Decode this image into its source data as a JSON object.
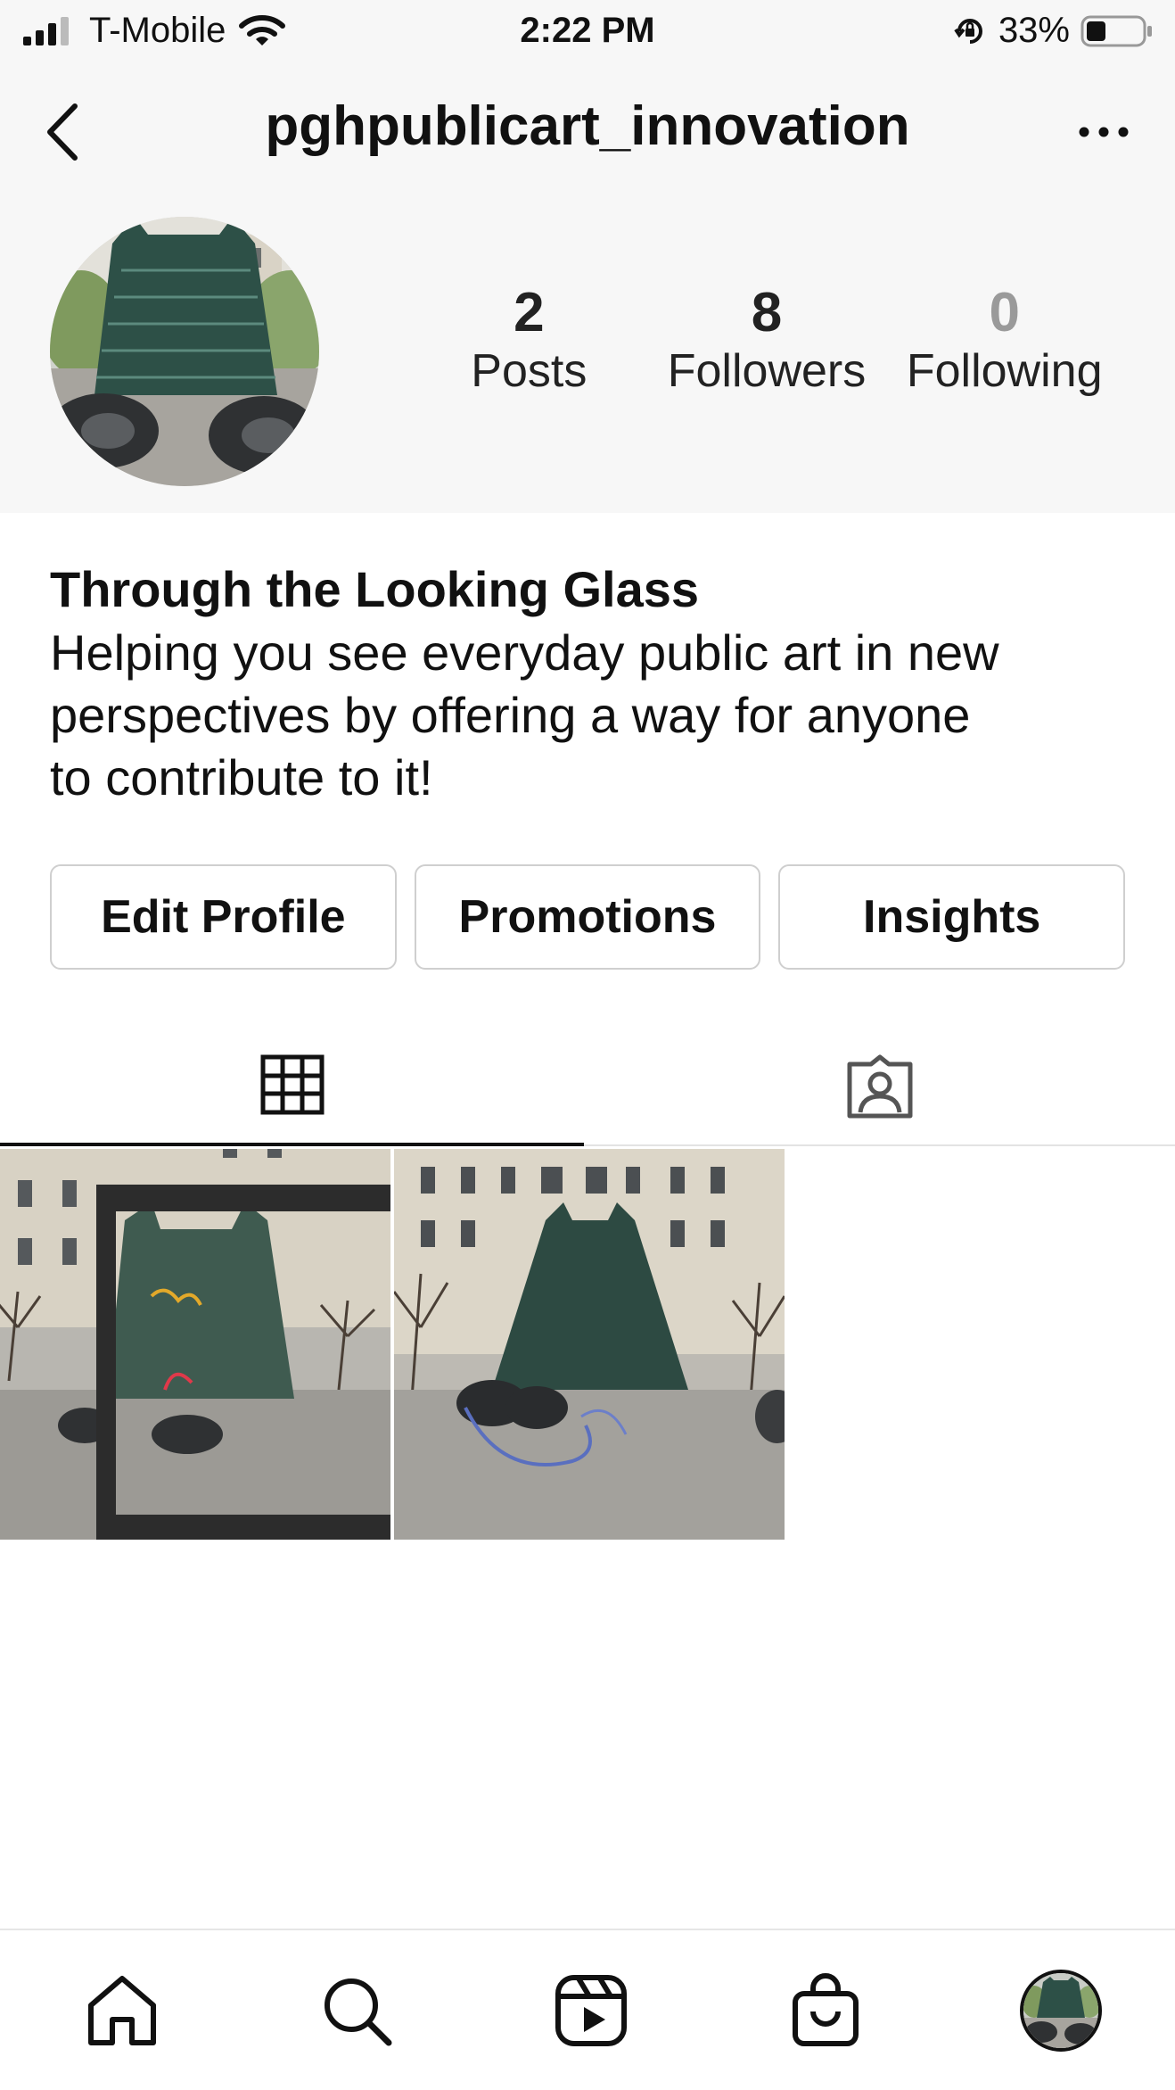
{
  "status_bar": {
    "carrier": "T-Mobile",
    "time": "2:22 PM",
    "battery": "33%",
    "icons": [
      "signal-icon",
      "wifi-icon",
      "orientation-lock-icon",
      "battery-icon"
    ]
  },
  "header": {
    "username": "pghpublicart_innovation",
    "back_icon": "chevron-left-icon",
    "more_icon": "more-horizontal-icon"
  },
  "stats": [
    {
      "count": "2",
      "label": "Posts"
    },
    {
      "count": "8",
      "label": "Followers"
    },
    {
      "count": "0",
      "label": "Following"
    }
  ],
  "bio": {
    "name": "Through the Looking Glass",
    "lines": [
      "Helping you see everyday public art in new",
      "perspectives by offering a way for anyone",
      "to contribute to it!"
    ]
  },
  "actions": {
    "edit_profile": "Edit Profile",
    "promotions": "Promotions",
    "insights": "Insights"
  },
  "tabs": {
    "active": "grid",
    "icons": [
      "grid-icon",
      "tagged-icon"
    ]
  },
  "bottom_nav": {
    "icons": [
      "home-icon",
      "search-icon",
      "reels-icon",
      "shop-icon",
      "profile-avatar"
    ]
  },
  "colors": {
    "top_background": "#f7f7f7",
    "text": "#111111",
    "muted": "#9a9a9a",
    "border": "#cfcfcf"
  }
}
